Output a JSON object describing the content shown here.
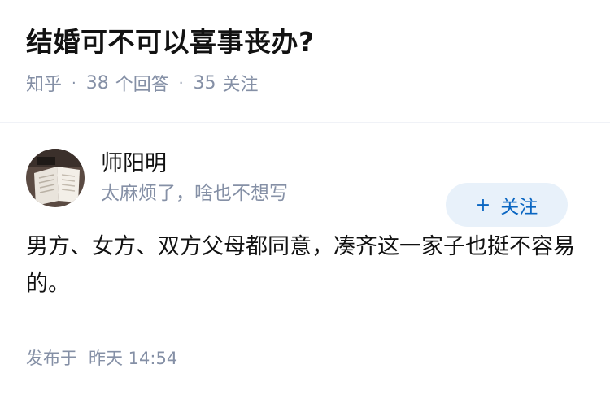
{
  "question": {
    "title": "结婚可不可以喜事丧办?",
    "source": "知乎",
    "answers_count": "38",
    "answers_label": "个回答",
    "followers_count": "35",
    "followers_label": "关注"
  },
  "answer": {
    "author_name": "师阳明",
    "author_bio": "太麻烦了，啥也不想写",
    "follow_button_label": "关注",
    "content": "男方、女方、双方父母都同意，凑齐这一家子也挺不容易的。",
    "publish_label": "发布于",
    "publish_time": "昨天 14:54"
  },
  "colors": {
    "meta_gray": "#8590a6",
    "follow_bg": "#e8f1fa",
    "follow_text": "#0a66c2"
  }
}
